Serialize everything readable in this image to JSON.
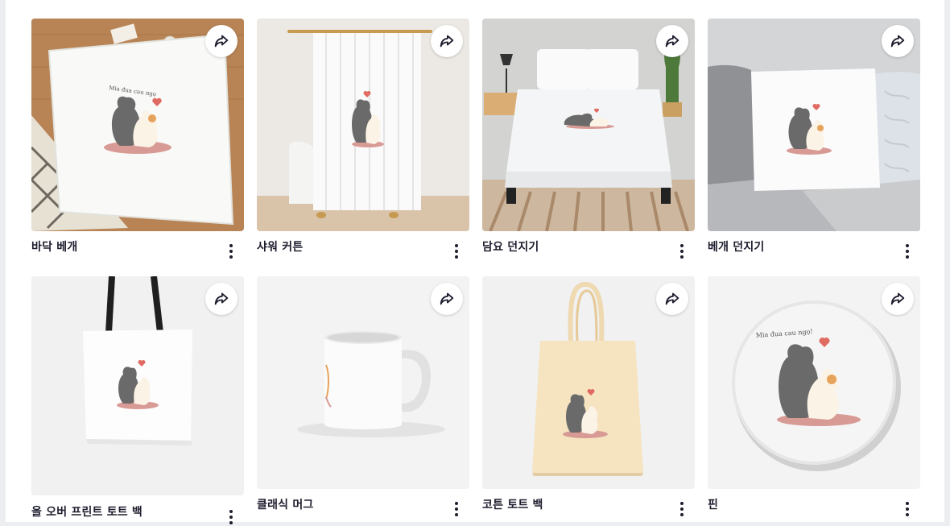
{
  "products": [
    {
      "title": "바닥 베개",
      "image_icon": "floor-pillow-image",
      "share_icon": "share-icon",
      "more_icon": "more-vertical-icon"
    },
    {
      "title": "샤워 커튼",
      "image_icon": "shower-curtain-image",
      "share_icon": "share-icon",
      "more_icon": "more-vertical-icon"
    },
    {
      "title": "담요 던지기",
      "image_icon": "throw-blanket-image",
      "share_icon": "share-icon",
      "more_icon": "more-vertical-icon"
    },
    {
      "title": "베개 던지기",
      "image_icon": "throw-pillow-image",
      "share_icon": "share-icon",
      "more_icon": "more-vertical-icon"
    },
    {
      "title": "올 오버 프린트 토트 백",
      "image_icon": "all-over-tote-image",
      "share_icon": "share-icon",
      "more_icon": "more-vertical-icon"
    },
    {
      "title": "클래식 머그",
      "image_icon": "classic-mug-image",
      "share_icon": "share-icon",
      "more_icon": "more-vertical-icon"
    },
    {
      "title": "코튼 토트 백",
      "image_icon": "cotton-tote-image",
      "share_icon": "share-icon",
      "more_icon": "more-vertical-icon"
    },
    {
      "title": "핀",
      "image_icon": "pin-button-image",
      "share_icon": "share-icon",
      "more_icon": "more-vertical-icon"
    }
  ],
  "colors": {
    "title_text": "#1d1d2e",
    "icon": "#1d1d2e",
    "card_background": "#f2f2f2",
    "page_background": "#ffffff"
  }
}
